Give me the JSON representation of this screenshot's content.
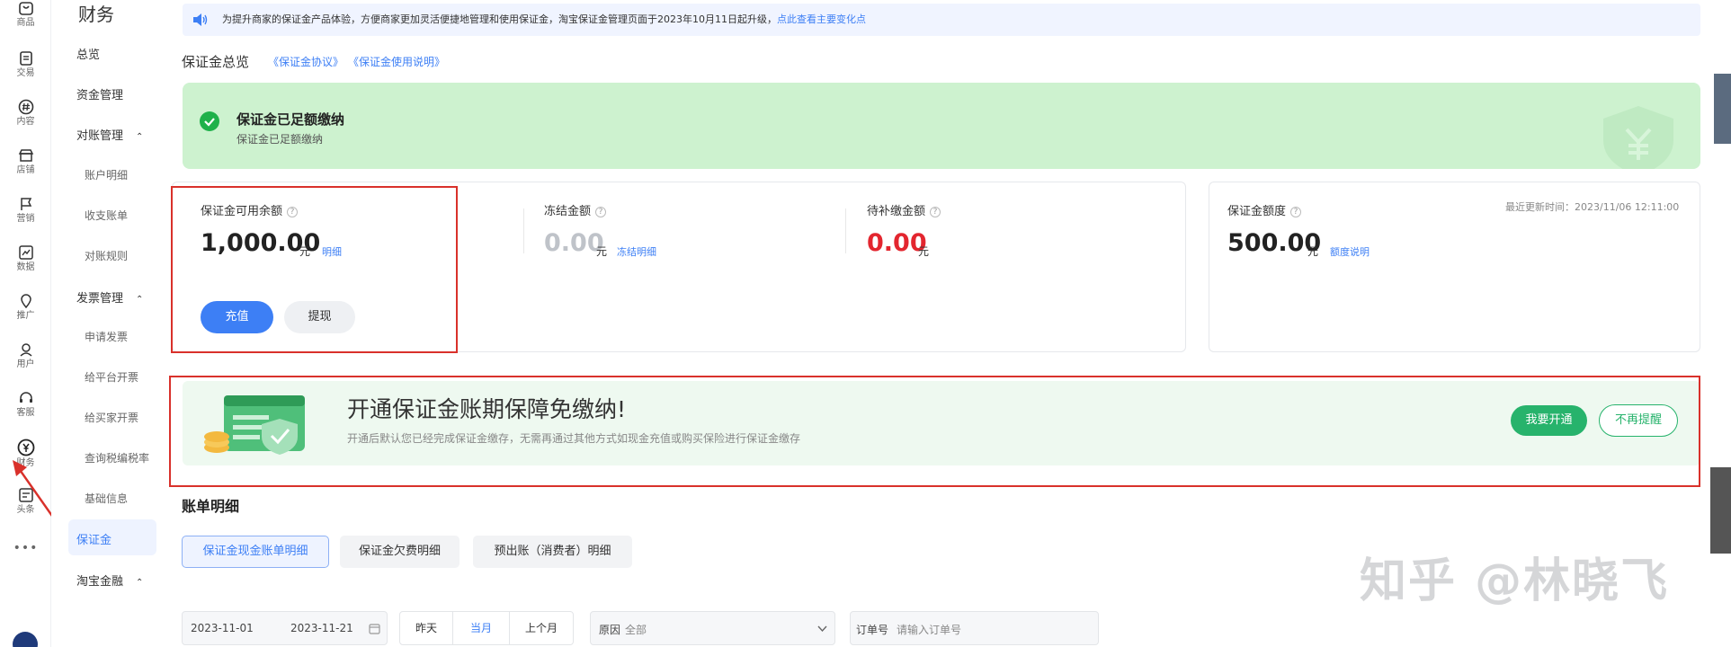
{
  "rail": {
    "items": [
      {
        "label": "商品",
        "icon": "bag-icon"
      },
      {
        "label": "交易",
        "icon": "receipt-icon"
      },
      {
        "label": "内容",
        "icon": "hash-icon"
      },
      {
        "label": "店铺",
        "icon": "store-icon"
      },
      {
        "label": "营销",
        "icon": "flag-icon"
      },
      {
        "label": "数据",
        "icon": "chart-icon"
      },
      {
        "label": "推广",
        "icon": "pin-icon"
      },
      {
        "label": "用户",
        "icon": "user-icon"
      },
      {
        "label": "客服",
        "icon": "headset-icon"
      },
      {
        "label": "财务",
        "icon": "yuan-icon"
      },
      {
        "label": "头条",
        "icon": "news-icon"
      }
    ],
    "more": "•••"
  },
  "subnav": {
    "title": "财务",
    "items": {
      "overview": "总览",
      "funds": "资金管理",
      "reconcile": "对账管理",
      "account_detail": "账户明细",
      "income_bill": "收支账单",
      "reconcile_rules": "对账规则",
      "invoice": "发票管理",
      "apply_invoice": "申请发票",
      "platform_invoice": "给平台开票",
      "buyer_invoice": "给买家开票",
      "tax_query": "查询税编税率",
      "basic_info": "基础信息",
      "deposit": "保证金",
      "taobao_finance": "淘宝金融"
    },
    "caret": "⌃"
  },
  "notice": {
    "text": "为提升商家的保证金产品体验，方便商家更加灵活便捷地管理和使用保证金，淘宝保证金管理页面于2023年10月11日起升级，",
    "link": "点此查看主要变化点"
  },
  "overview": {
    "title": "保证金总览",
    "agreement_link": "《保证金协议》",
    "guide_link": "《保证金使用说明》"
  },
  "status_banner": {
    "title": "保证金已足额缴纳",
    "subtitle": "保证金已足额缴纳"
  },
  "balance_card": {
    "available_label": "保证金可用余额",
    "available_value": "1,000.00",
    "unit": "元",
    "detail_link": "明细",
    "frozen_label": "冻结金额",
    "frozen_value": "0.00",
    "frozen_link": "冻结明细",
    "pending_label": "待补缴金额",
    "pending_value": "0.00",
    "recharge_button": "充值",
    "withdraw_button": "提现",
    "help": "?"
  },
  "quota_card": {
    "label": "保证金额度",
    "value": "500.00",
    "unit": "元",
    "link": "额度说明",
    "update_time": "最近更新时间：2023/11/06 12:11:00"
  },
  "promo": {
    "headline": "开通保证金账期保障免缴纳!",
    "description": "开通后默认您已经完成保证金缴存，无需再通过其他方式如现金充值或购买保险进行保证金缴存",
    "open_button": "我要开通",
    "dismiss_button": "不再提醒"
  },
  "bill": {
    "title": "账单明细",
    "tabs": [
      "保证金现金账单明细",
      "保证金欠费明细",
      "预出账（消费者）明细"
    ],
    "date_start": "2023-11-01",
    "date_end": "2023-11-21",
    "quick_ranges": [
      "昨天",
      "当月",
      "上个月"
    ],
    "reason_label": "原因",
    "reason_value": "全部",
    "order_label": "订单号",
    "order_placeholder": "请输入订单号"
  },
  "watermark": "知乎 @林晓飞",
  "colors": {
    "accent": "#3d7ff5",
    "green": "#27b36c",
    "red": "#e3262f",
    "highlight_box": "#d9312b"
  }
}
